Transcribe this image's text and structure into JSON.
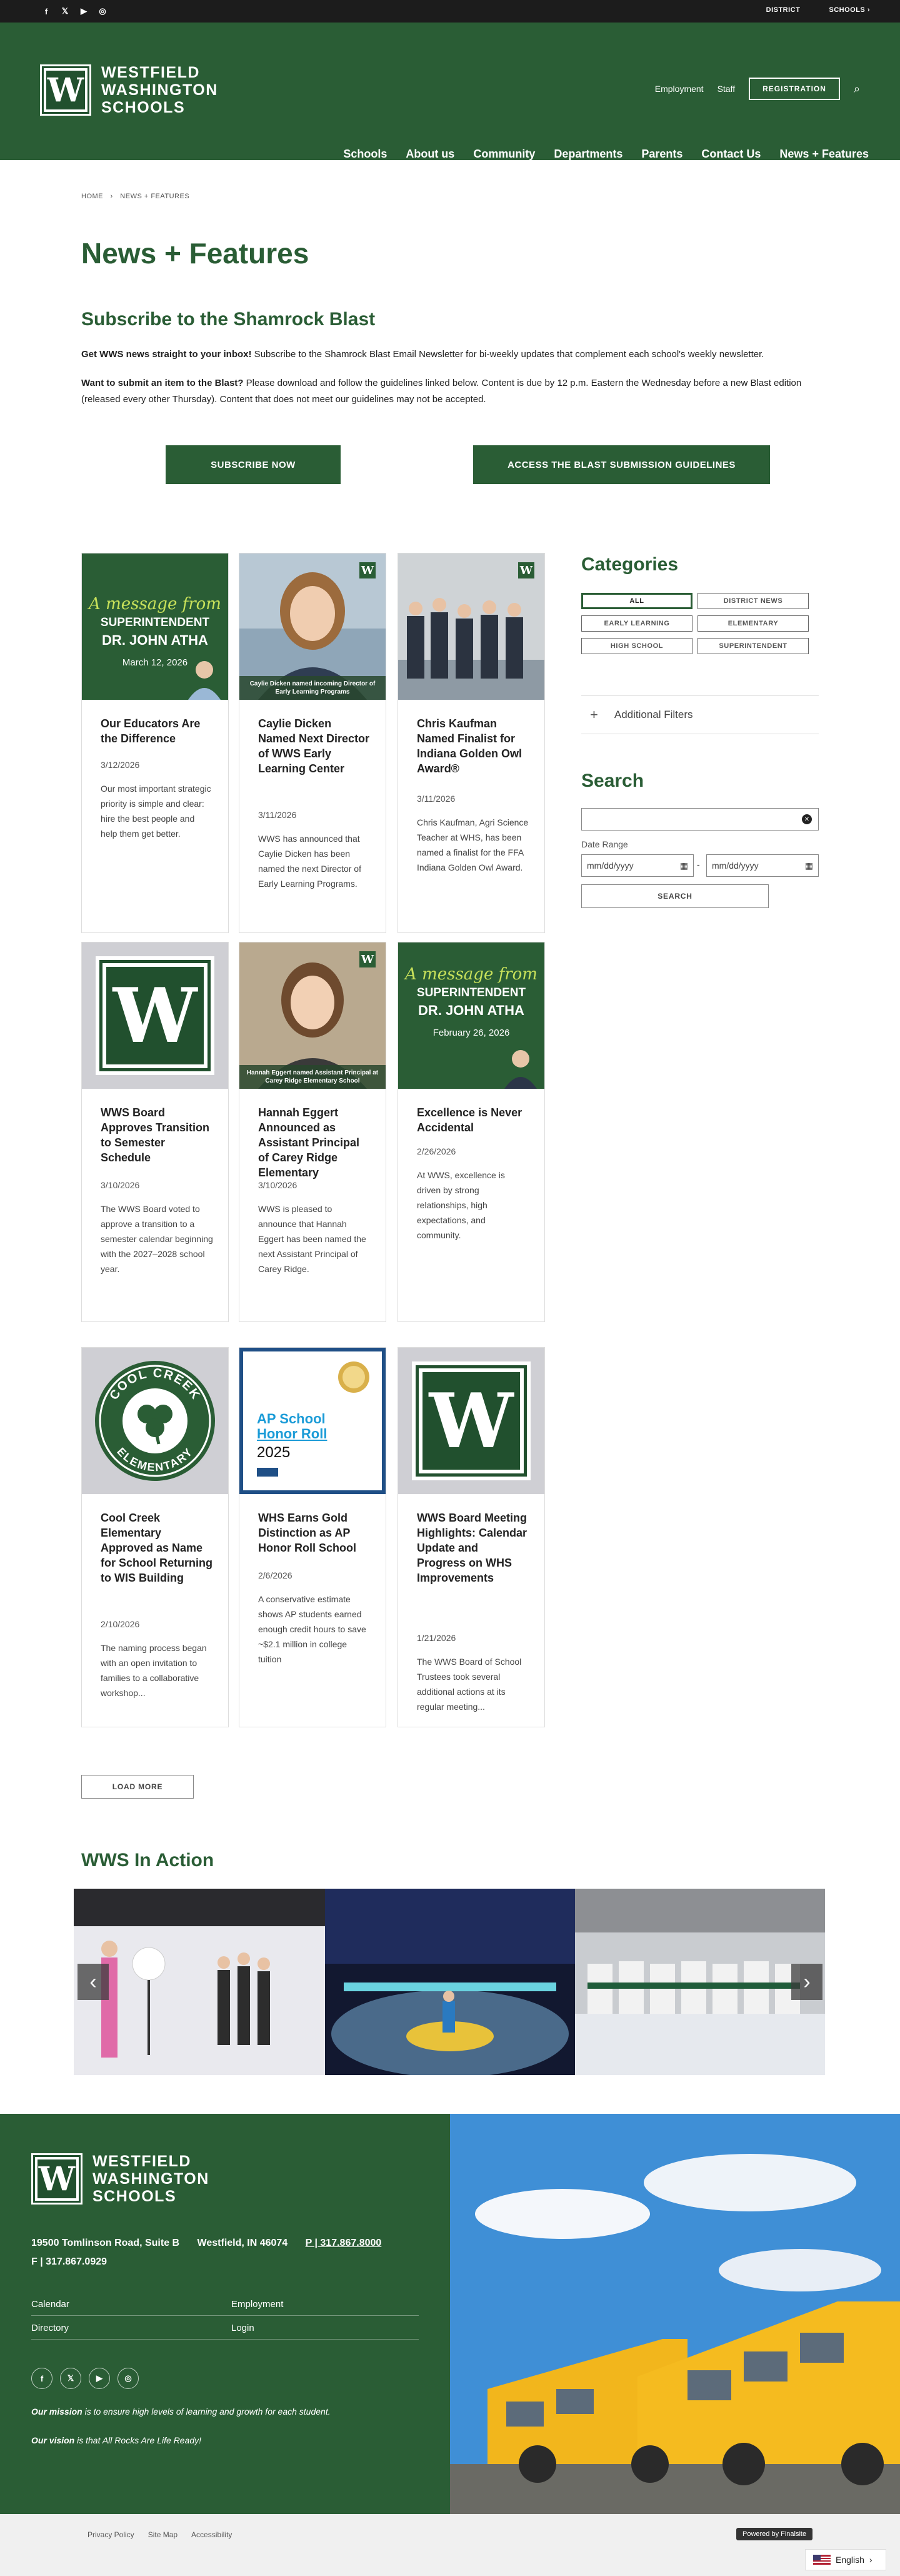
{
  "topbar": {
    "links": [
      "DISTRICT",
      "SCHOOLS"
    ],
    "social": [
      "facebook-icon",
      "x-icon",
      "youtube-icon",
      "instagram-icon"
    ]
  },
  "brand": {
    "logo_letter": "W",
    "name_line1": "WESTFIELD",
    "name_line2": "WASHINGTON",
    "name_line3": "SCHOOLS"
  },
  "utility": {
    "employment": "Employment",
    "staff": "Staff",
    "registration": "REGISTRATION"
  },
  "nav": [
    "Schools",
    "About us",
    "Community",
    "Departments",
    "Parents",
    "Contact Us",
    "News + Features"
  ],
  "breadcrumb": {
    "home": "HOME",
    "current": "NEWS + FEATURES",
    "sep": "›"
  },
  "page_title": "News + Features",
  "subscribe": {
    "heading": "Subscribe to the Shamrock Blast",
    "p1_bold": "Get WWS news straight to your inbox!",
    "p1_text": " Subscribe to the Shamrock Blast Email Newsletter for bi-weekly updates that complement each school's weekly newsletter.",
    "p2_bold": "Want to submit an item to the Blast?",
    "p2_text": " Please download and follow the guidelines linked below. Content is due by 12 p.m. Eastern the Wednesday before a new Blast edition (released every other Thursday). Content that does not meet our guidelines may not be accepted.",
    "btn_subscribe": "SUBSCRIBE NOW",
    "btn_guidelines": "ACCESS THE BLAST SUBMISSION GUIDELINES"
  },
  "cards": [
    {
      "title": "Our Educators Are the Difference",
      "date": "3/12/2026",
      "desc": "Our most important strategic priority is simple and clear: hire the best people and help them get better.",
      "msg_a": "A message from",
      "msg_b": "SUPERINTENDENT",
      "msg_c": "DR. JOHN ATHA",
      "msg_d": "March 12, 2026"
    },
    {
      "title": "Caylie Dicken Named Next Director of WWS Early Learning Center",
      "date": "3/11/2026",
      "desc": "WWS has announced that Caylie Dicken has been named the next Director of Early Learning Programs.",
      "caption": "Caylie Dicken named incoming Director of Early Learning Programs"
    },
    {
      "title": "Chris Kaufman Named Finalist for Indiana Golden Owl Award®",
      "date": "3/11/2026",
      "desc": "Chris Kaufman, Agri Science Teacher at WHS, has been named a finalist for the FFA Indiana Golden Owl Award."
    },
    {
      "title": "WWS Board Approves Transition to Semester Schedule",
      "date": "3/10/2026",
      "desc": "The WWS Board voted to approve a transition to a semester calendar beginning with the 2027–2028 school year."
    },
    {
      "title": "Hannah Eggert Announced as Assistant Principal of Carey Ridge Elementary",
      "date": "3/10/2026",
      "desc": "WWS is pleased to announce that Hannah Eggert has been named the next Assistant Principal of Carey Ridge.",
      "caption": "Hannah Eggert named Assistant Principal at Carey Ridge Elementary School"
    },
    {
      "title": "Excellence is Never Accidental",
      "date": "2/26/2026",
      "desc": "At WWS, excellence is driven by strong relationships, high expectations, and community.",
      "msg_a": "A message from",
      "msg_b": "SUPERINTENDENT",
      "msg_c": "DR. JOHN ATHA",
      "msg_d": "February 26, 2026"
    },
    {
      "title": "Cool Creek Elementary Approved as Name for School Returning to WIS Building",
      "date": "2/10/2026",
      "desc": "The naming process began with an open invitation to families to a collaborative workshop...",
      "seal_top": "COOL CREEK",
      "seal_bottom": "ELEMENTARY"
    },
    {
      "title": "WHS Earns Gold Distinction as AP Honor Roll School",
      "date": "2/6/2026",
      "desc": "A conservative estimate shows AP students earned enough credit hours to save ~$2.1 million in college tuition",
      "ap_line1": "AP School",
      "ap_line2": "Honor Roll",
      "ap_year": "2025"
    },
    {
      "title": "WWS Board Meeting Highlights: Calendar Update and Progress on WHS Improvements",
      "date": "1/21/2026",
      "desc": "The WWS Board of School Trustees took several additional actions at its regular meeting..."
    }
  ],
  "load_more": "LOAD MORE",
  "categories": {
    "heading": "Categories",
    "items": [
      "ALL",
      "DISTRICT NEWS",
      "EARLY LEARNING",
      "ELEMENTARY",
      "HIGH SCHOOL",
      "SUPERINTENDENT"
    ],
    "selected": "ALL"
  },
  "filters": {
    "label": "Additional Filters"
  },
  "search": {
    "heading": "Search",
    "date_range": "Date Range",
    "date_placeholder": "mm/dd/yyyy",
    "dash": "-",
    "button": "SEARCH"
  },
  "in_action": {
    "heading": "WWS In Action"
  },
  "footer": {
    "address": "19500 Tomlinson Road, Suite B",
    "city": "Westfield, IN  46074",
    "phone": "P | 317.867.8000",
    "fax": "F | 317.867.0929",
    "links": [
      "Calendar",
      "Employment",
      "Directory",
      "Login"
    ],
    "mission_bold": "Our mission",
    "mission_text": " is to ensure high levels of learning and growth for each student.",
    "vision_bold": "Our vision",
    "vision_text": " is that All Rocks Are Life Ready!"
  },
  "bottom": {
    "links": [
      "Privacy Policy",
      "Site Map",
      "Accessibility"
    ],
    "powered": "Powered by Finalsite",
    "language": "English"
  },
  "colors": {
    "brand_green": "#2a5d35",
    "topbar": "#1c1c1c"
  }
}
